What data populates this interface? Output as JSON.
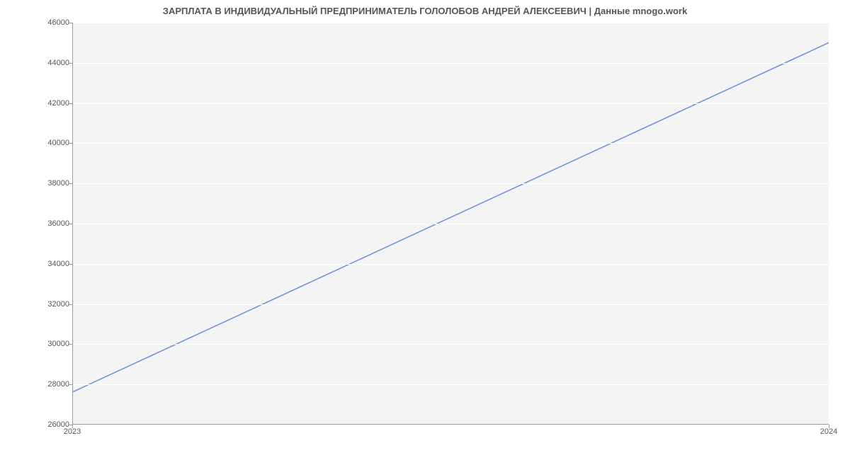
{
  "chart_data": {
    "type": "line",
    "title": "ЗАРПЛАТА В ИНДИВИДУАЛЬНЫЙ ПРЕДПРИНИМАТЕЛЬ ГОЛОЛОБОВ АНДРЕЙ АЛЕКСЕЕВИЧ | Данные mnogo.work",
    "xlabel": "",
    "ylabel": "",
    "x": [
      "2023",
      "2024"
    ],
    "y": [
      27600,
      45000
    ],
    "ylim": [
      26000,
      46000
    ],
    "y_ticks": [
      26000,
      28000,
      30000,
      32000,
      34000,
      36000,
      38000,
      40000,
      42000,
      44000,
      46000
    ],
    "x_ticks": [
      "2023",
      "2024"
    ],
    "line_color": "#6a8fd8",
    "grid": true
  }
}
